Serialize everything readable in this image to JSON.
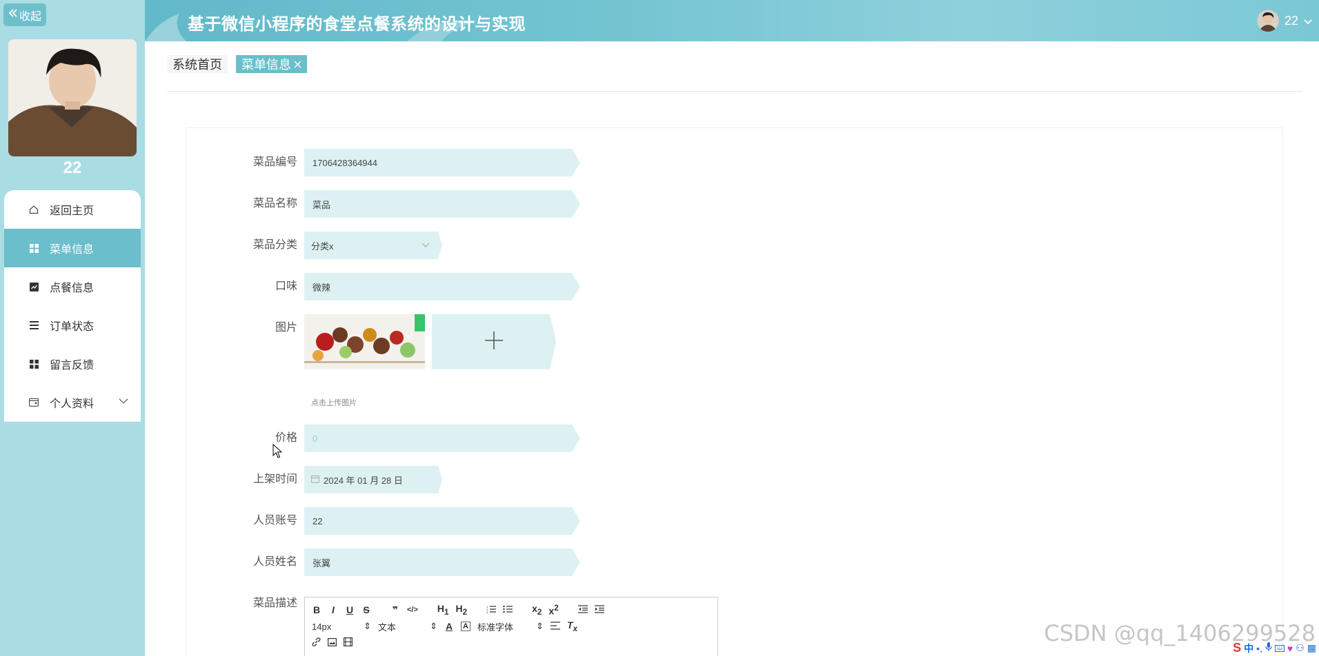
{
  "sidebar": {
    "collapse_label": "收起",
    "username": "22",
    "menu": [
      {
        "label": "返回主页",
        "icon": "home-icon"
      },
      {
        "label": "菜单信息",
        "icon": "grid-icon",
        "active": true
      },
      {
        "label": "点餐信息",
        "icon": "chart-icon"
      },
      {
        "label": "订单状态",
        "icon": "list-icon"
      },
      {
        "label": "留言反馈",
        "icon": "apps-icon"
      },
      {
        "label": "个人资料",
        "icon": "wallet-icon",
        "expandable": true
      }
    ]
  },
  "header": {
    "title": "基于微信小程序的食堂点餐系统的设计与实现",
    "user": "22"
  },
  "tabs": [
    {
      "label": "系统首页"
    },
    {
      "label": "菜单信息",
      "closable": true
    }
  ],
  "form": {
    "code": {
      "label": "菜品编号",
      "value": "1706428364944"
    },
    "name": {
      "label": "菜品名称",
      "value": "菜品"
    },
    "category": {
      "label": "菜品分类",
      "value": "分类x"
    },
    "taste": {
      "label": "口味",
      "value": "微辣"
    },
    "image": {
      "label": "图片",
      "tip": "点击上传图片"
    },
    "price": {
      "label": "价格",
      "value": "0"
    },
    "shelf_time": {
      "label": "上架时间",
      "value": "2024 年 01 月 28 日"
    },
    "account": {
      "label": "人员账号",
      "value": "22"
    },
    "staff_name": {
      "label": "人员姓名",
      "value": "张翼"
    },
    "description": {
      "label": "菜品描述"
    }
  },
  "editor": {
    "font_size": "14px",
    "paragraph": "文本",
    "font_family": "标准字体"
  },
  "watermark": "CSDN @qq_1406299528",
  "colors": {
    "accent": "#6bbecb",
    "sidebar_bg": "#a9dde3",
    "input_bg": "#ddf1f3"
  }
}
